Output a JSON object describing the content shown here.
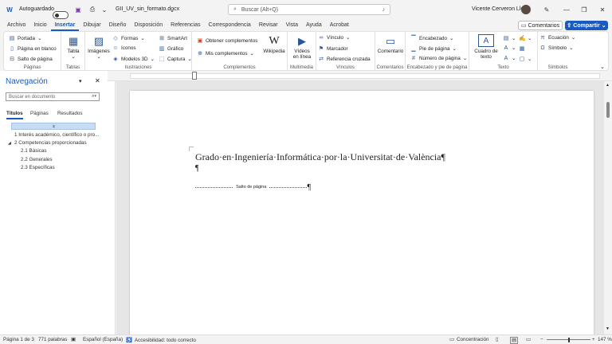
{
  "titlebar": {
    "autosave_label": "Autoguardado",
    "doc_name": "GII_UV_sin_formato.docx",
    "search_placeholder": "Buscar (Alt+Q)",
    "user_name": "Vicente Cerveron Lleó"
  },
  "tabs": [
    "Archivo",
    "Inicio",
    "Insertar",
    "Dibujar",
    "Diseño",
    "Disposición",
    "Referencias",
    "Correspondencia",
    "Revisar",
    "Vista",
    "Ayuda",
    "Acrobat"
  ],
  "active_tab": "Insertar",
  "buttons": {
    "comments": "Comentarios",
    "share": "Compartir"
  },
  "ribbon": {
    "paginas": {
      "name": "Páginas",
      "items": [
        "Portada",
        "Página en blanco",
        "Salto de página"
      ]
    },
    "tablas": {
      "name": "Tablas",
      "table": "Tabla"
    },
    "ilustraciones": {
      "name": "Ilustraciones",
      "images": "Imágenes",
      "items": [
        "Formas",
        "Iconos",
        "Modelos 3D",
        "SmartArt",
        "Gráfico",
        "Captura"
      ]
    },
    "complementos": {
      "name": "Complementos",
      "items": [
        "Obtener complementos",
        "Mis complementos"
      ],
      "wikipedia": "Wikipedia"
    },
    "multimedia": {
      "name": "Multimedia",
      "video_line1": "Vídeos",
      "video_line2": "en línea"
    },
    "vinculos": {
      "name": "Vínculos",
      "items": [
        "Vínculo",
        "Marcador",
        "Referencia cruzada"
      ]
    },
    "comentarios": {
      "name": "Comentarios",
      "comment": "Comentario"
    },
    "encabezado": {
      "name": "Encabezado y pie de página",
      "items": [
        "Encabezado",
        "Pie de página",
        "Número de página"
      ]
    },
    "texto": {
      "name": "Texto",
      "textbox_line1": "Cuadro de",
      "textbox_line2": "texto"
    },
    "simbolos": {
      "name": "Símbolos",
      "items": [
        "Ecuación",
        "Símbolo"
      ]
    }
  },
  "nav": {
    "title": "Navegación",
    "search_placeholder": "Buscar en documento",
    "tabs": [
      "Títulos",
      "Páginas",
      "Resultados"
    ],
    "headings": [
      {
        "text": "1 Interés académico, científico o pro...",
        "level": 1
      },
      {
        "text": "2 Competencias proporcionadas",
        "level": 1
      },
      {
        "text": "2.1 Básicas",
        "level": 2
      },
      {
        "text": "2.2 Generales",
        "level": 2
      },
      {
        "text": "2.3 Específicas",
        "level": 2
      }
    ]
  },
  "document": {
    "title": "Grado·en·Ingeniería·Informática·por·la·Universitat·de·València¶",
    "empty_para": "¶",
    "page_break": "Salto de página",
    "page_break_mark": "¶"
  },
  "status": {
    "page": "Página 1 de 3",
    "words": "771 palabras",
    "language": "Español (España)",
    "accessibility": "Accesibilidad: todo correcto",
    "focus": "Concentración",
    "zoom": "147 %"
  }
}
